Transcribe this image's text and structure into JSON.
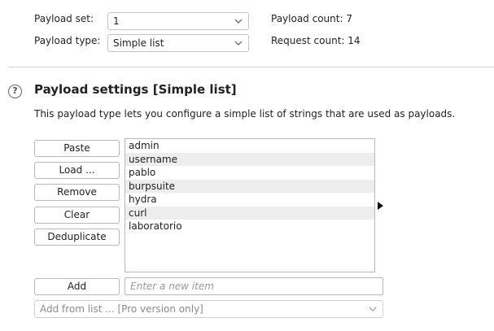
{
  "payload_set": {
    "label": "Payload set:",
    "value": "1"
  },
  "payload_type": {
    "label": "Payload type:",
    "value": "Simple list"
  },
  "payload_count": {
    "label": "Payload count:",
    "value": "7"
  },
  "request_count": {
    "label": "Request count:",
    "value": "14"
  },
  "settings": {
    "help_icon": "?",
    "title": "Payload settings [Simple list]",
    "description": "This payload type lets you configure a simple list of strings that are used as payloads."
  },
  "buttons": {
    "paste": "Paste",
    "load": "Load ...",
    "remove": "Remove",
    "clear": "Clear",
    "deduplicate": "Deduplicate",
    "add": "Add"
  },
  "list_items": [
    "admin",
    "username",
    "pablo",
    "burpsuite",
    "hydra",
    "curl",
    "laboratorio"
  ],
  "new_item_input": {
    "placeholder": "Enter a new item"
  },
  "add_from_list": {
    "value": "Add from list ... [Pro version only]"
  },
  "icons": {
    "dropdown": "chevron-down-icon",
    "help": "help-circle-icon",
    "arrow": "play-arrow-icon"
  }
}
